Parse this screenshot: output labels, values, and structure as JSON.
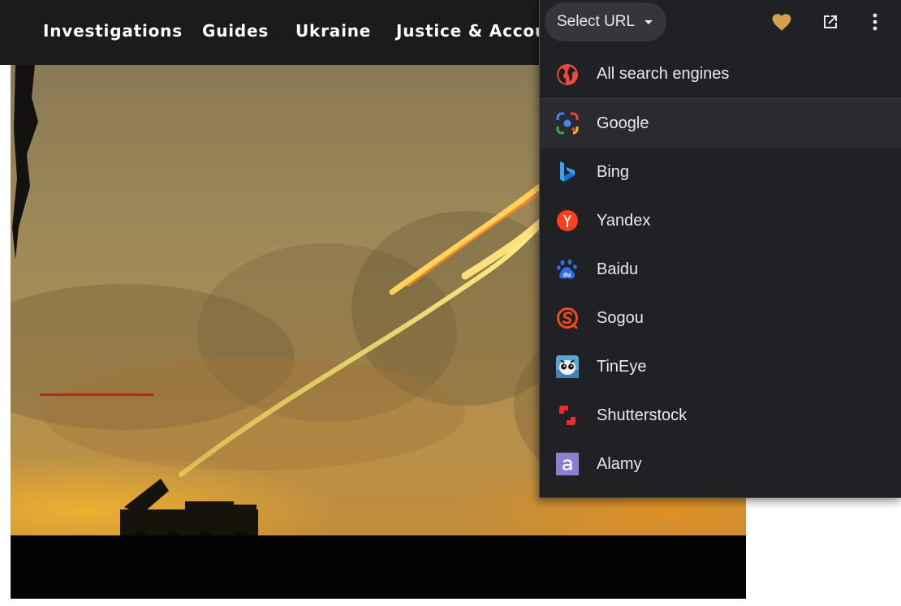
{
  "nav": {
    "items": [
      "Investigations",
      "Guides",
      "Ukraine",
      "Justice & Accou"
    ]
  },
  "popup": {
    "select_label": "Select URL",
    "header_icons": [
      "heart-icon",
      "open-in-new-icon",
      "more-vert-icon"
    ],
    "accent_color": "#d4a24c",
    "items": [
      {
        "label": "All search engines",
        "icon": "globe-icon"
      },
      {
        "label": "Google",
        "icon": "google-lens-icon",
        "highlighted": true
      },
      {
        "label": "Bing",
        "icon": "bing-icon"
      },
      {
        "label": "Yandex",
        "icon": "yandex-icon"
      },
      {
        "label": "Baidu",
        "icon": "baidu-icon"
      },
      {
        "label": "Sogou",
        "icon": "sogou-icon"
      },
      {
        "label": "TinEye",
        "icon": "tineye-icon"
      },
      {
        "label": "Shutterstock",
        "icon": "shutterstock-icon"
      },
      {
        "label": "Alamy",
        "icon": "alamy-icon"
      }
    ]
  }
}
